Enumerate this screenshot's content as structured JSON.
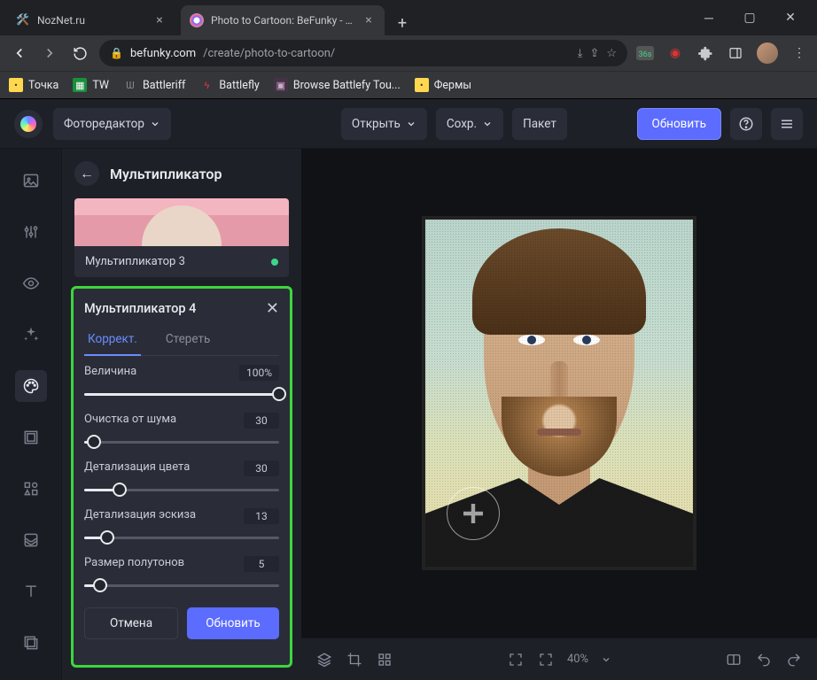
{
  "browser": {
    "tabs": [
      {
        "title": "NozNet.ru"
      },
      {
        "title": "Photo to Cartoon: BeFunky - Cart"
      }
    ],
    "url_host": "befunky.com",
    "url_path": "/create/photo-to-cartoon/",
    "bookmarks": [
      "Точка",
      "TW",
      "Battleriff",
      "Battlefly",
      "Browse Battlefy Tou...",
      "Фермы"
    ]
  },
  "app": {
    "editor_dropdown": "Фоторедактор",
    "open": "Открыть",
    "save": "Сохр.",
    "batch": "Пакет",
    "update": "Обновить"
  },
  "panel": {
    "title": "Мультипликатор",
    "preview_label": "Мультипликатор 3",
    "card": {
      "title": "Мультипликатор 4",
      "tab_adjust": "Коррект.",
      "tab_erase": "Стереть",
      "sliders": {
        "amount": {
          "label": "Величина",
          "value": "100%",
          "pct": 100
        },
        "denoise": {
          "label": "Очистка от шума",
          "value": "30",
          "pct": 5
        },
        "colord": {
          "label": "Детализация цвета",
          "value": "30",
          "pct": 18
        },
        "sketchd": {
          "label": "Детализация эскиза",
          "value": "13",
          "pct": 12
        },
        "halftone": {
          "label": "Размер полутонов",
          "value": "5",
          "pct": 8
        }
      },
      "cancel": "Отмена",
      "apply": "Обновить"
    }
  },
  "bottom": {
    "zoom": "40%"
  }
}
